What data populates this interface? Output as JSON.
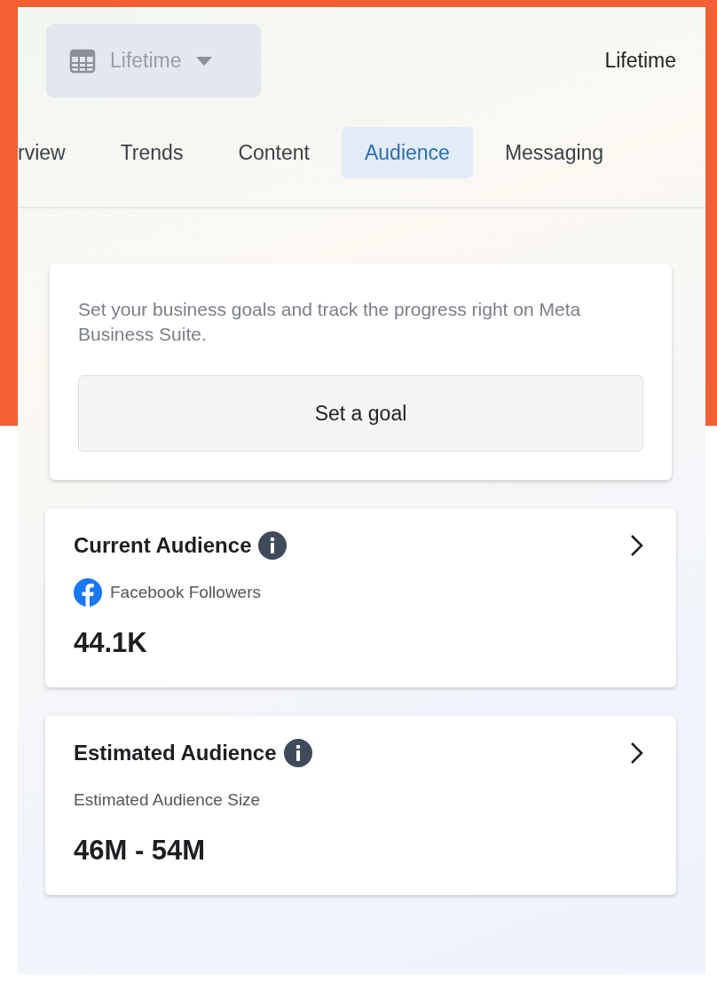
{
  "date_filter": {
    "label": "Lifetime"
  },
  "range_label": "Lifetime",
  "tabs": [
    {
      "label": "rview",
      "selected": false
    },
    {
      "label": "Trends",
      "selected": false
    },
    {
      "label": "Content",
      "selected": false
    },
    {
      "label": "Audience",
      "selected": true
    },
    {
      "label": "Messaging",
      "selected": false
    }
  ],
  "goal_card": {
    "text": "Set your business goals and track the progress right on Meta Business Suite.",
    "button": "Set a goal"
  },
  "cards": [
    {
      "title": "Current Audience",
      "kind": "facebook",
      "metric_label": "Facebook Followers",
      "value": "44.1K"
    },
    {
      "title": "Estimated Audience",
      "kind": "plain",
      "metric_label": "Estimated Audience Size",
      "value": "46M - 54M"
    }
  ]
}
